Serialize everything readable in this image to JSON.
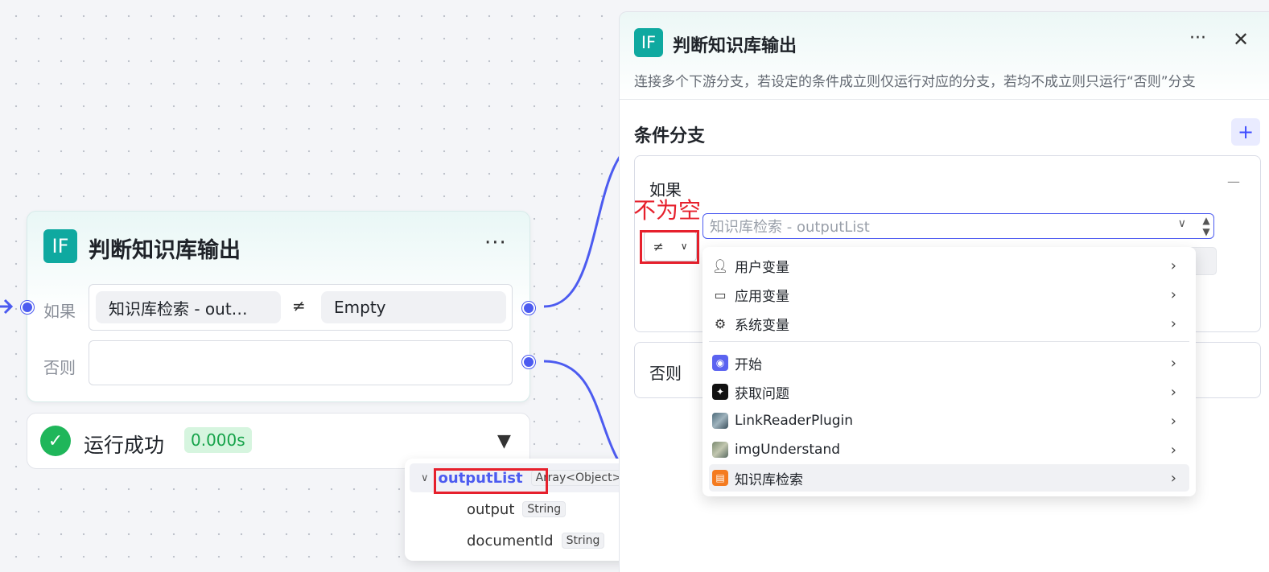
{
  "node": {
    "icon": "IF",
    "title": "判断知识库输出",
    "more": "···",
    "if_label": "如果",
    "else_label": "否则",
    "condition": {
      "variable": "知识库检索 - out…",
      "operator": "≠",
      "value": "Empty"
    }
  },
  "run": {
    "status": "运行成功",
    "time": "0.000s",
    "chevron": "⌄"
  },
  "output_tree": {
    "items": [
      {
        "name": "outputList",
        "type": "Array<Object>"
      },
      {
        "name": "output",
        "type": "String"
      },
      {
        "name": "documentId",
        "type": "String"
      }
    ]
  },
  "panel": {
    "icon": "IF",
    "title": "判断知识库输出",
    "more": "···",
    "close": "✕",
    "description": "连接多个下游分支，若设定的条件成立则仅运行对应的分支，若均不成立则只运行“否则”分支",
    "section_title": "条件分支",
    "add": "+",
    "if_label": "如果",
    "remove": "—",
    "else_label": "否则",
    "annotation": "不为空",
    "operator": "≠",
    "variable_placeholder": "知识库检索 - outputList",
    "menu": {
      "items": [
        {
          "label": "用户变量",
          "icon": "user-icon"
        },
        {
          "label": "应用变量",
          "icon": "folder-icon"
        },
        {
          "label": "系统变量",
          "icon": "gear-icon"
        },
        {
          "label": "开始",
          "icon": "start-node-icon"
        },
        {
          "label": "获取问题",
          "icon": "question-node-icon"
        },
        {
          "label": "LinkReaderPlugin",
          "icon": "plugin-image-icon"
        },
        {
          "label": "imgUnderstand",
          "icon": "plugin-image-icon"
        },
        {
          "label": "知识库检索",
          "icon": "knowledge-search-icon"
        }
      ]
    }
  },
  "colors": {
    "accent": "#4c5bf0",
    "teal": "#0fa9a0",
    "highlight": "#e6202c",
    "success": "#1fb65a"
  }
}
